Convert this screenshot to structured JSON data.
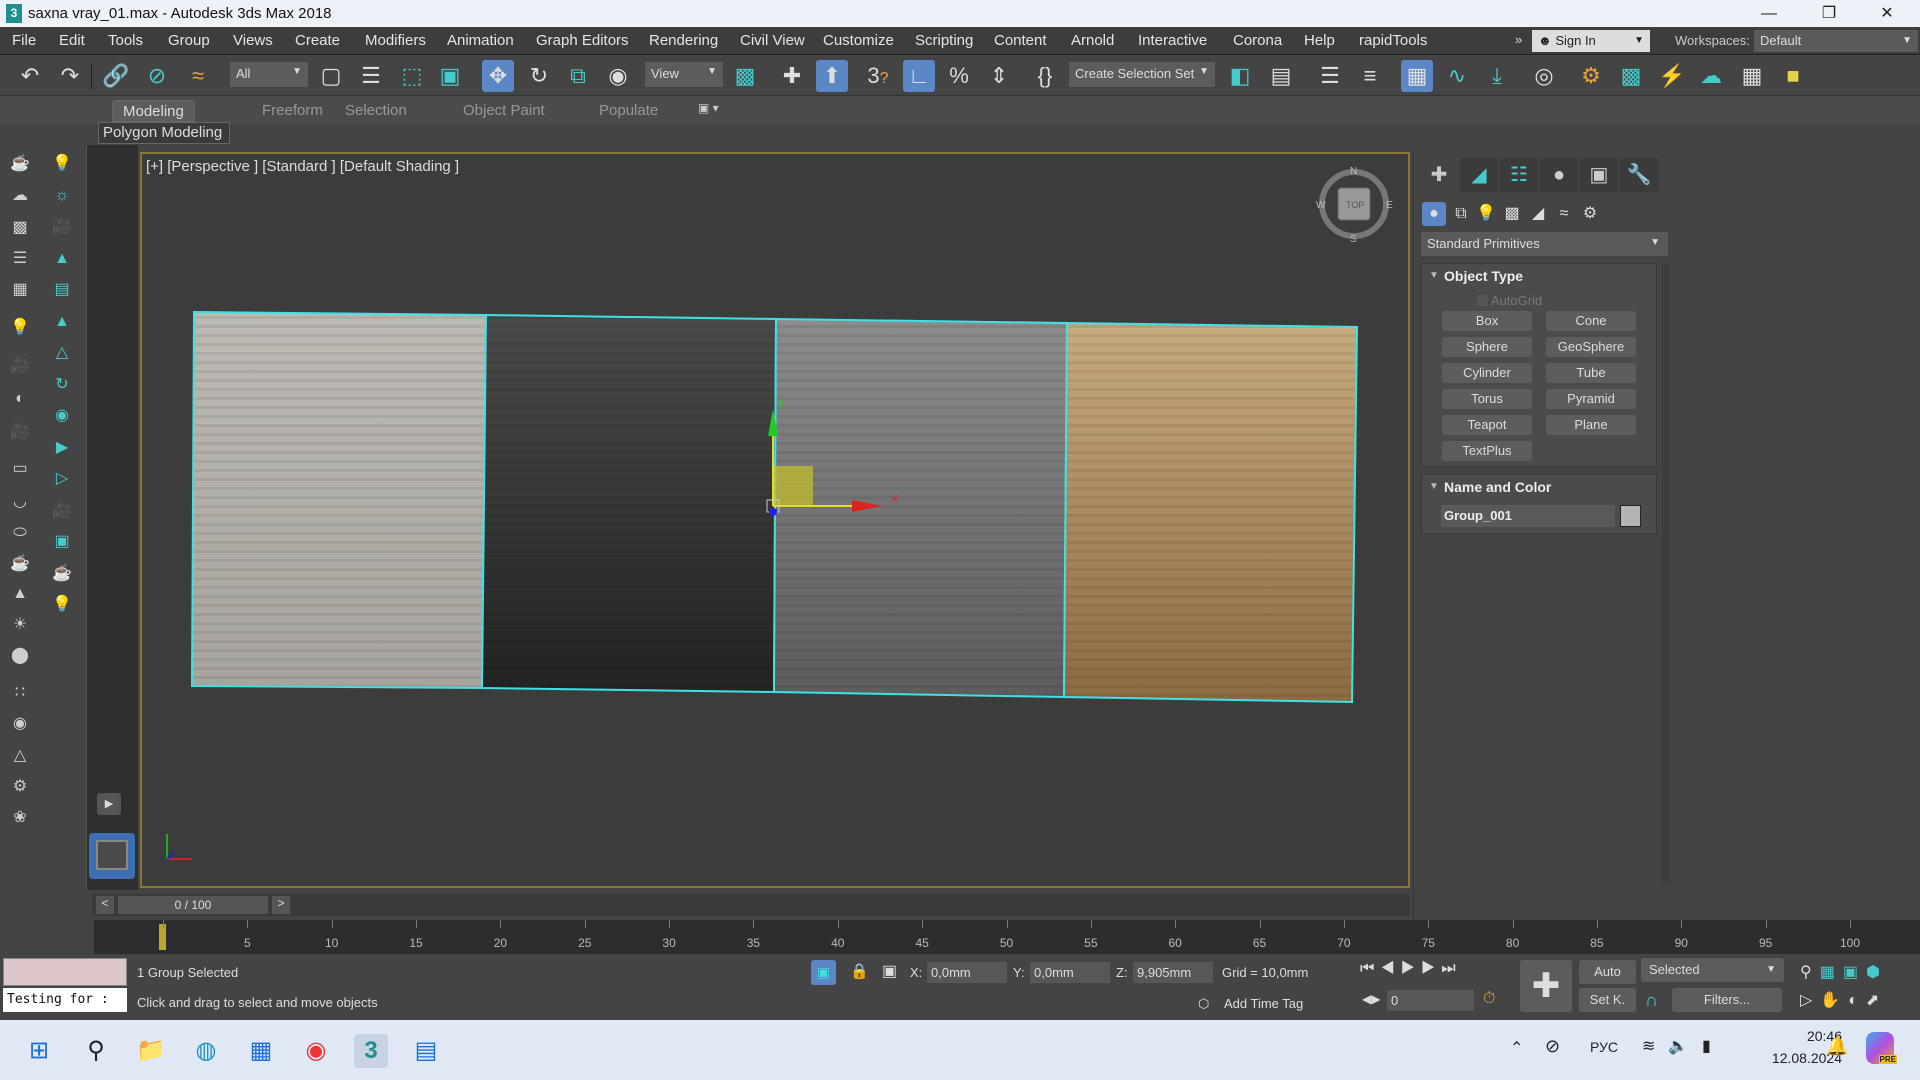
{
  "window": {
    "title": "saxna vray_01.max - Autodesk 3ds Max 2018",
    "app_icon": "3"
  },
  "menu": [
    "File",
    "Edit",
    "Tools",
    "Group",
    "Views",
    "Create",
    "Modifiers",
    "Animation",
    "Graph Editors",
    "Rendering",
    "Civil View",
    "Customize",
    "Scripting",
    "Content",
    "Arnold",
    "Interactive",
    "Corona",
    "Help",
    "rapidTools"
  ],
  "signin": {
    "label": "Sign In",
    "workspaces_label": "Workspaces:",
    "workspace": "Default"
  },
  "toolbar": {
    "filter": "All",
    "ref_coord": "View",
    "selection_set": "Create Selection Set",
    "snap_label": "3"
  },
  "ribbon": {
    "tabs": [
      "Modeling",
      "Freeform",
      "Selection",
      "Object Paint",
      "Populate"
    ],
    "active": "Modeling",
    "panel": "Polygon Modeling"
  },
  "viewport": {
    "label": "[+] [Perspective ] [Standard ] [Default Shading ]",
    "gizmo_x": "x",
    "gizmo_y": "y",
    "viewcube": {
      "face": "TOP",
      "n": "N",
      "s": "S",
      "e": "E",
      "w": "W"
    }
  },
  "command_panel": {
    "category": "Standard Primitives",
    "object_type": {
      "title": "Object Type",
      "autogrid": "AutoGrid",
      "buttons": [
        "Box",
        "Cone",
        "Sphere",
        "GeoSphere",
        "Cylinder",
        "Tube",
        "Torus",
        "Pyramid",
        "Teapot",
        "Plane",
        "TextPlus"
      ]
    },
    "name_color": {
      "title": "Name and Color",
      "name": "Group_001",
      "color": "#b4b4b4"
    }
  },
  "timeline": {
    "frame": "0 / 100",
    "prev": "<",
    "next": ">",
    "ticks": [
      "5",
      "10",
      "15",
      "20",
      "25",
      "30",
      "35",
      "40",
      "45",
      "50",
      "55",
      "60",
      "65",
      "70",
      "75",
      "80",
      "85",
      "90",
      "95",
      "100"
    ]
  },
  "status": {
    "selection": "1 Group Selected",
    "prompt": "Click and drag to select and move objects",
    "script_listener": "Testing for :",
    "x_label": "X:",
    "x": "0,0mm",
    "y_label": "Y:",
    "y": "0,0mm",
    "z_label": "Z:",
    "z": "9,905mm",
    "grid": "Grid = 10,0mm",
    "add_time_tag": "Add Time Tag",
    "frame_value": "0",
    "auto_key": "Auto",
    "set_key": "Set K.",
    "key_mode": "Selected",
    "filters": "Filters..."
  },
  "taskbar": {
    "lang": "РУС",
    "time": "20:46",
    "date": "12.08.2024",
    "copilot_badge": "PRE"
  },
  "colors": {
    "accent": "#5b87c6",
    "selection": "#3fe0e8",
    "viewport_border": "#8a7634"
  }
}
